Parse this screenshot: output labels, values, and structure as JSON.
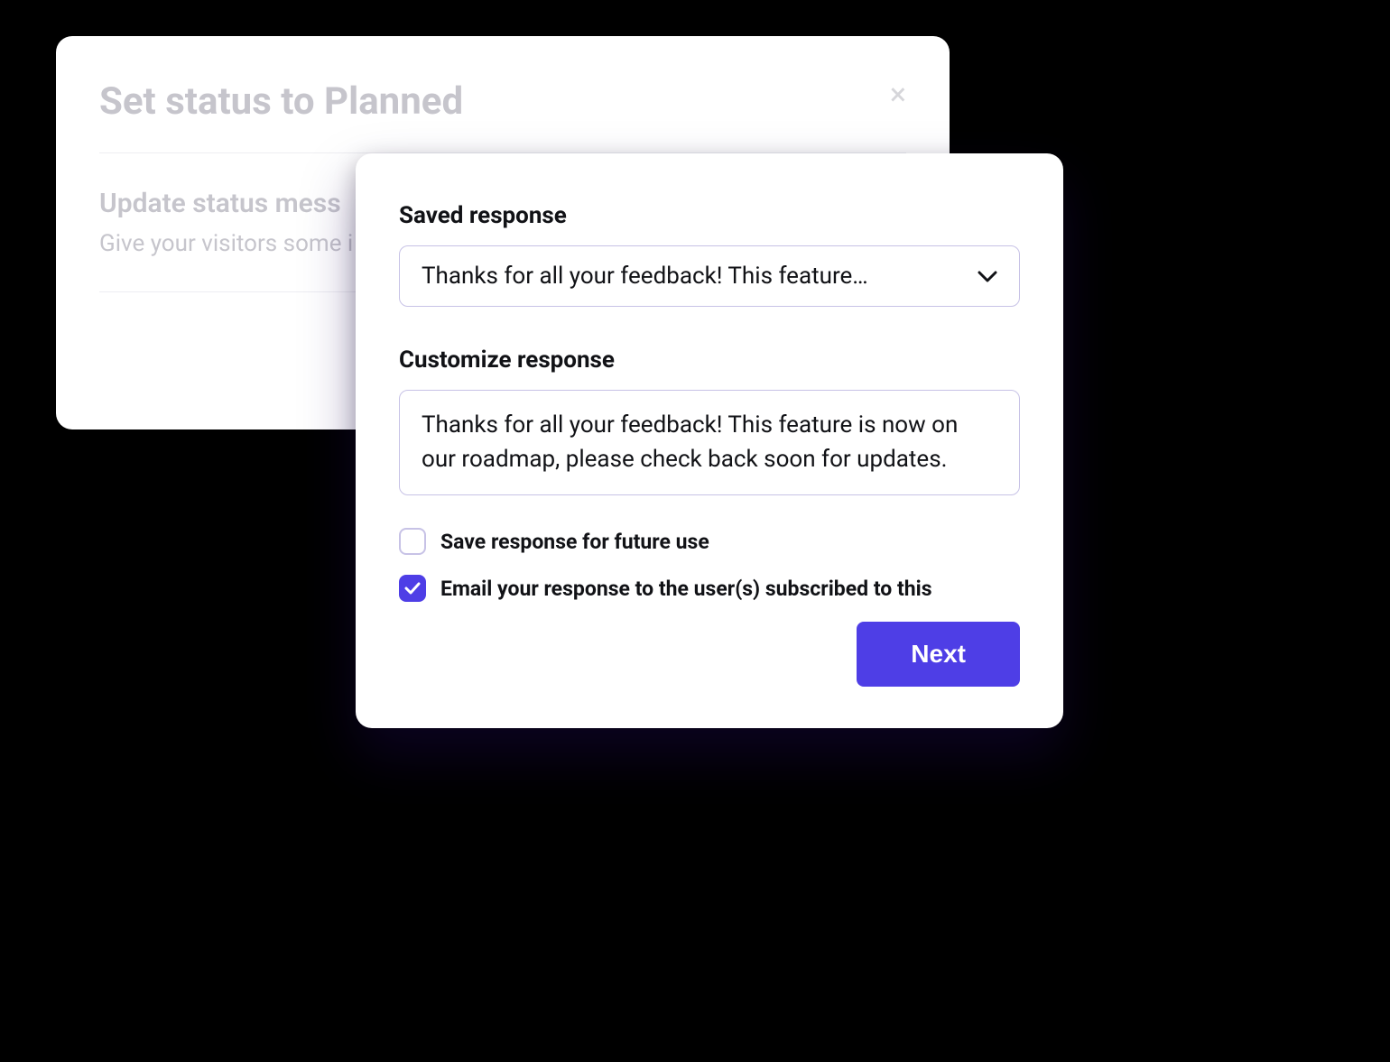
{
  "back_modal": {
    "title": "Set status to Planned",
    "subtitle": "Update status mess",
    "help_text": "Give your visitors some i"
  },
  "front_modal": {
    "saved_response_label": "Saved response",
    "saved_response_selected": "Thanks for all your feedback! This feature…",
    "customize_label": "Customize response",
    "customize_value": "Thanks for all your feedback! This feature is now on our roadmap, please check back soon for updates.",
    "checkboxes": {
      "save_future": {
        "label": "Save response for future use",
        "checked": false
      },
      "email_users": {
        "label": "Email your response to the user(s) subscribed to this",
        "checked": true
      }
    },
    "next_label": "Next"
  },
  "colors": {
    "accent": "#4e3ee6",
    "border": "#c7c2e6"
  }
}
